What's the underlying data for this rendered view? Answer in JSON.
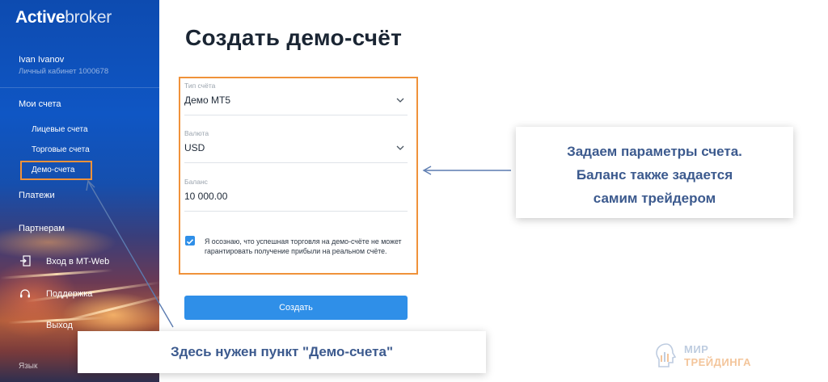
{
  "brand": {
    "bold": "Active",
    "light": "broker"
  },
  "user": {
    "name": "Ivan Ivanov",
    "cabinet": "Личный кабинет 1000678"
  },
  "nav": {
    "my_accounts": "Мои счета",
    "personal_accounts": "Лицевые счета",
    "trading_accounts": "Торговые счета",
    "demo_accounts": "Демо-счета",
    "payments": "Платежи",
    "partners": "Партнерам",
    "mt_web": "Вход в MT-Web",
    "support": "Поддержка",
    "logout": "Выход",
    "language": "Язык"
  },
  "page": {
    "title": "Создать демо-счёт"
  },
  "form": {
    "account_type": {
      "label": "Тип счёта",
      "value": "Демо MT5"
    },
    "currency": {
      "label": "Валюта",
      "value": "USD"
    },
    "balance": {
      "label": "Баланс",
      "value": "10 000.00"
    },
    "agreement": {
      "checked": true,
      "text": "Я осознаю, что успешная торговля на демо-счёте не может гарантировать получение прибыли на реальном счёте."
    },
    "submit_label": "Создать"
  },
  "callouts": {
    "right": [
      "Задаем параметры счета.",
      "Баланс также задается",
      "самим трейдером"
    ],
    "bottom": "Здесь нужен пункт \"Демо-счета\""
  },
  "watermark": {
    "line1": "МИР",
    "line2": "ТРЕЙДИНГА"
  },
  "colors": {
    "accent": "#2f8fe8",
    "highlight": "#f0923a",
    "callout_text": "#3c5a8e",
    "arrow": "#5b7bb0"
  }
}
